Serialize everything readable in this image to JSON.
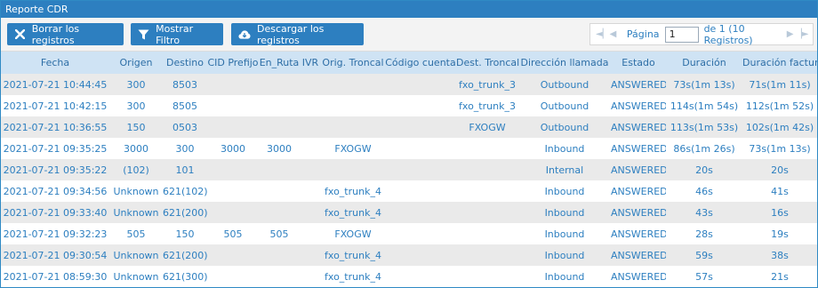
{
  "window": {
    "title": "Reporte CDR"
  },
  "toolbar": {
    "delete_label": "Borrar los registros",
    "filter_label": "Mostrar Filtro",
    "download_label": "Descargar los registros"
  },
  "pager": {
    "page_label": "Página",
    "page_value": "1",
    "total_label": "de 1 (10 Registros)"
  },
  "table": {
    "headers": [
      "Fecha",
      "Origen",
      "Destino",
      "CID Prefijo",
      "En_Ruta",
      "IVR",
      "Orig. Troncal",
      "Código cuenta",
      "Dest. Troncal",
      "Dirección llamada",
      "Estado",
      "Duración",
      "Duración facturac."
    ],
    "rows": [
      [
        "2021-07-21 10:44:45",
        "300",
        "8503",
        "",
        "",
        "",
        "",
        "",
        "fxo_trunk_3",
        "Outbound",
        "ANSWERED",
        "73s(1m 13s)",
        "71s(1m 11s)"
      ],
      [
        "2021-07-21 10:42:15",
        "300",
        "8505",
        "",
        "",
        "",
        "",
        "",
        "fxo_trunk_3",
        "Outbound",
        "ANSWERED",
        "114s(1m 54s)",
        "112s(1m 52s)"
      ],
      [
        "2021-07-21 10:36:55",
        "150",
        "0503",
        "",
        "",
        "",
        "",
        "",
        "FXOGW",
        "Outbound",
        "ANSWERED",
        "113s(1m 53s)",
        "102s(1m 42s)"
      ],
      [
        "2021-07-21 09:35:25",
        "3000",
        "300",
        "3000",
        "3000",
        "",
        "FXOGW",
        "",
        "",
        "Inbound",
        "ANSWERED",
        "86s(1m 26s)",
        "73s(1m 13s)"
      ],
      [
        "2021-07-21 09:35:22",
        "(102)",
        "101",
        "",
        "",
        "",
        "",
        "",
        "",
        "Internal",
        "ANSWERED",
        "20s",
        "20s"
      ],
      [
        "2021-07-21 09:34:56",
        "Unknown",
        "621(102)",
        "",
        "",
        "",
        "fxo_trunk_4",
        "",
        "",
        "Inbound",
        "ANSWERED",
        "46s",
        "41s"
      ],
      [
        "2021-07-21 09:33:40",
        "Unknown",
        "621(200)",
        "",
        "",
        "",
        "fxo_trunk_4",
        "",
        "",
        "Inbound",
        "ANSWERED",
        "43s",
        "16s"
      ],
      [
        "2021-07-21 09:32:23",
        "505",
        "150",
        "505",
        "505",
        "",
        "FXOGW",
        "",
        "",
        "Inbound",
        "ANSWERED",
        "28s",
        "19s"
      ],
      [
        "2021-07-21 09:30:54",
        "Unknown",
        "621(200)",
        "",
        "",
        "",
        "fxo_trunk_4",
        "",
        "",
        "Inbound",
        "ANSWERED",
        "59s",
        "38s"
      ],
      [
        "2021-07-21 08:59:30",
        "Unknown",
        "621(300)",
        "",
        "",
        "",
        "fxo_trunk_4",
        "",
        "",
        "Inbound",
        "ANSWERED",
        "57s",
        "21s"
      ]
    ]
  },
  "icons": {
    "delete": "close-icon",
    "filter": "filter-icon",
    "download": "cloud-download-icon",
    "first": "first-page-icon",
    "prev": "prev-page-icon",
    "next": "next-page-icon",
    "last": "last-page-icon"
  },
  "colors": {
    "accent": "#2d7fc0",
    "header_bg": "#cfe3f4",
    "row_alt": "#eaeaea",
    "text_link": "#2d7fc0"
  }
}
